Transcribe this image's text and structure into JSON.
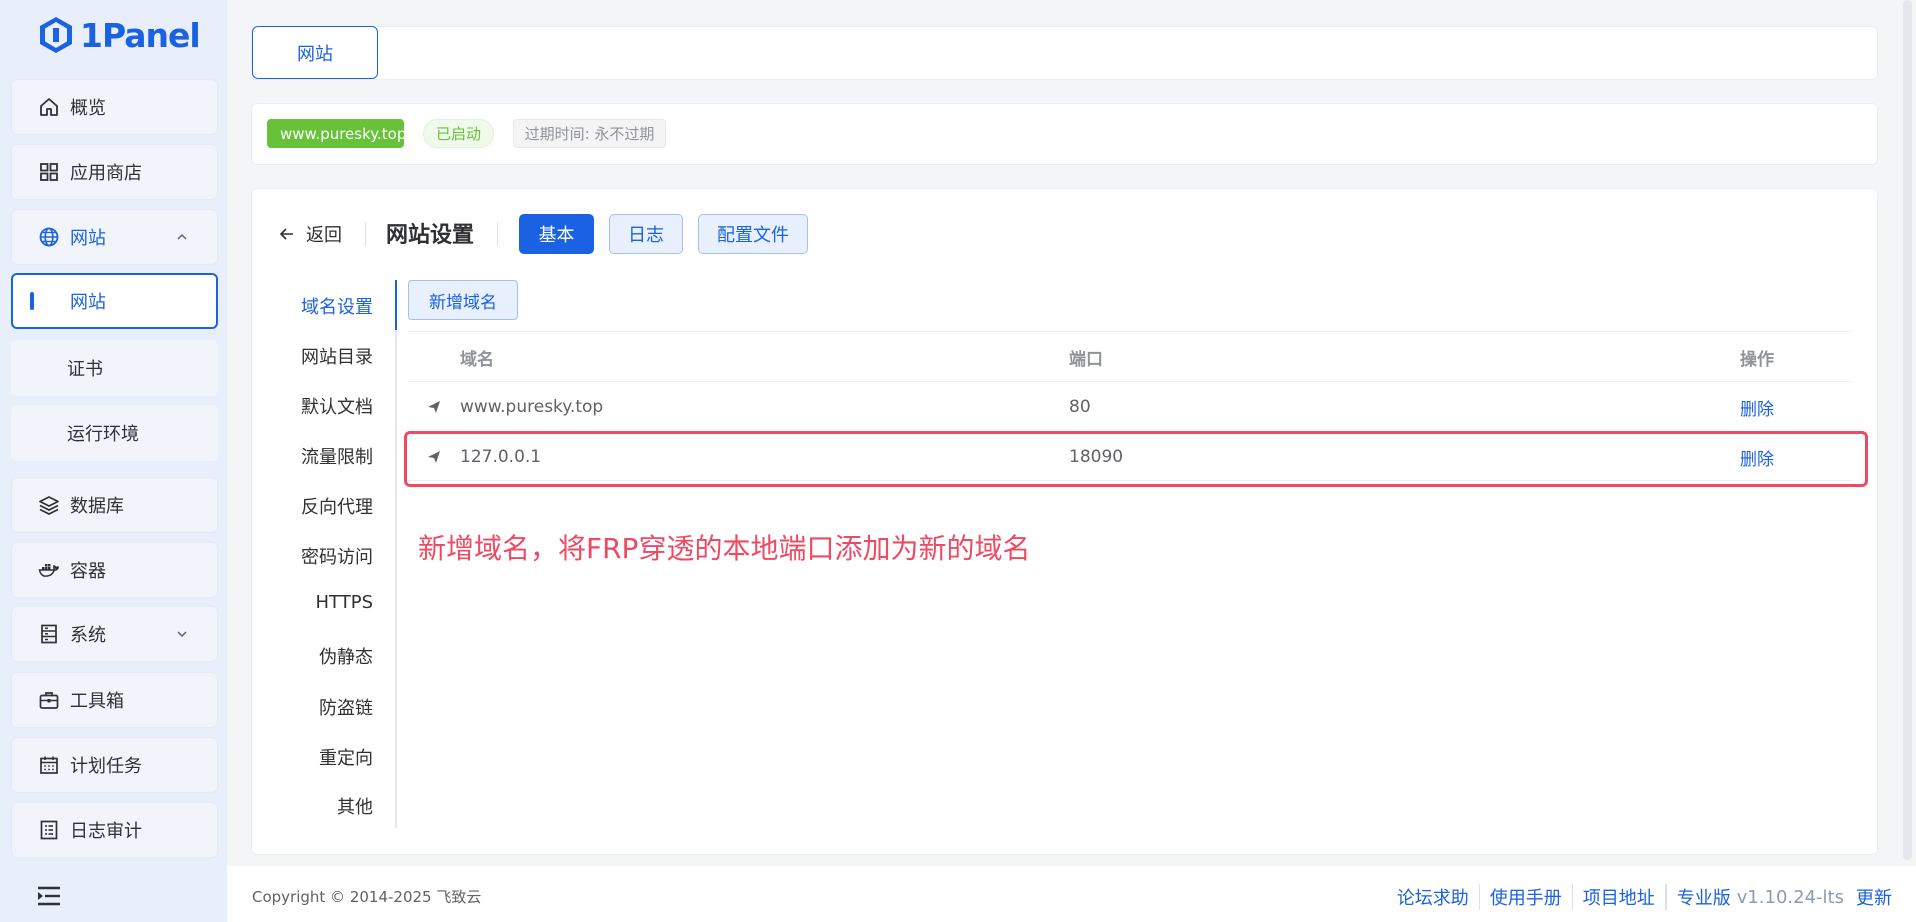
{
  "app": {
    "name": "1Panel"
  },
  "sidebar": {
    "items": [
      {
        "label": "概览",
        "icon": "home-icon"
      },
      {
        "label": "应用商店",
        "icon": "grid-icon"
      },
      {
        "label": "网站",
        "icon": "globe-icon"
      },
      {
        "label": "网站",
        "icon": ""
      },
      {
        "label": "证书",
        "icon": ""
      },
      {
        "label": "运行环境",
        "icon": ""
      },
      {
        "label": "数据库",
        "icon": "layers-icon"
      },
      {
        "label": "容器",
        "icon": "docker-icon"
      },
      {
        "label": "系统",
        "icon": "server-icon"
      },
      {
        "label": "工具箱",
        "icon": "toolbox-icon"
      },
      {
        "label": "计划任务",
        "icon": "calendar-icon"
      },
      {
        "label": "日志审计",
        "icon": "log-icon"
      }
    ]
  },
  "tabs": {
    "website": "网站"
  },
  "site_info": {
    "domain": "www.puresky.top",
    "status": "已启动",
    "expire": "过期时间: 永不过期"
  },
  "settings": {
    "back_label": "返回",
    "title": "网站设置",
    "tabs": [
      "基本",
      "日志",
      "配置文件"
    ],
    "menu": [
      "域名设置",
      "网站目录",
      "默认文档",
      "流量限制",
      "反向代理",
      "密码访问",
      "HTTPS",
      "伪静态",
      "防盗链",
      "重定向",
      "其他"
    ],
    "add_domain_label": "新增域名"
  },
  "domain_table": {
    "headers": {
      "domain": "域名",
      "port": "端口",
      "op": "操作"
    },
    "rows": [
      {
        "domain": "www.puresky.top",
        "port": "80",
        "op": "删除"
      },
      {
        "domain": "127.0.0.1",
        "port": "18090",
        "op": "删除"
      }
    ]
  },
  "annotation": "新增域名，将FRP穿透的本地端口添加为新的域名",
  "footer": {
    "copyright": "Copyright © 2014-2025 飞致云",
    "links": [
      "论坛求助",
      "使用手册",
      "项目地址"
    ],
    "edition": "专业版",
    "version": "v1.10.24-lts",
    "update": "更新"
  },
  "colors": {
    "accent": "#1a62e2",
    "success": "#67c23a",
    "highlight": "#ef4a63"
  }
}
